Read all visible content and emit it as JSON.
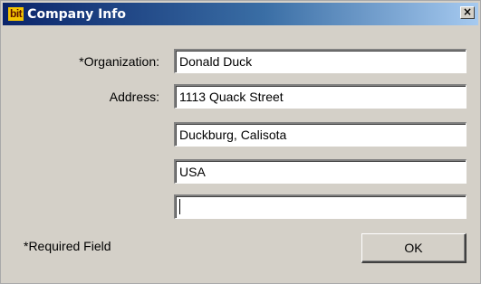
{
  "window": {
    "title": "Company Info",
    "logo_text": "bit",
    "close_glyph": "×"
  },
  "form": {
    "organization": {
      "label": "*Organization:",
      "value": "Donald Duck"
    },
    "address": {
      "label": "Address:",
      "line1": "1113 Quack Street",
      "line2": "Duckburg, Calisota",
      "line3": "USA",
      "line4": ""
    }
  },
  "footer": {
    "required_note": "*Required Field",
    "ok_label": "OK"
  },
  "colors": {
    "dialog_bg": "#d4d0c8",
    "titlebar_start": "#0a246a",
    "titlebar_end": "#a6caf0",
    "logo_bg": "#f4c400"
  },
  "icons": {
    "logo": "bit-logo-icon",
    "close": "close-icon"
  }
}
